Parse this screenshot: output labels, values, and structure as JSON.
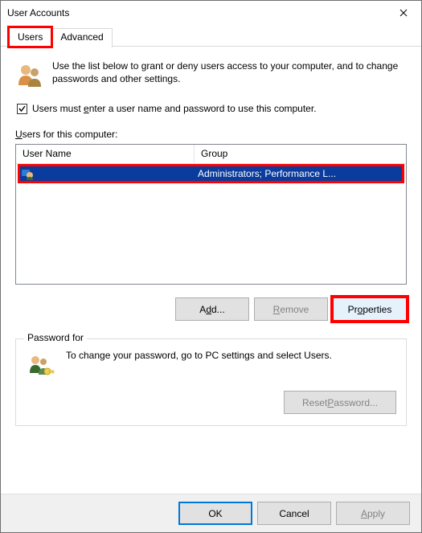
{
  "window": {
    "title": "User Accounts"
  },
  "tabs": [
    {
      "label": "Users",
      "active": true
    },
    {
      "label": "Advanced",
      "active": false
    }
  ],
  "intro": "Use the list below to grant or deny users access to your computer, and to change passwords and other settings.",
  "checkbox": {
    "checked": true,
    "label_pre": "Users must ",
    "label_hot": "e",
    "label_post": "nter a user name and password to use this computer."
  },
  "usersLabel": {
    "hot": "U",
    "rest": "sers for this computer:"
  },
  "columns": {
    "name": "User Name",
    "group": "Group"
  },
  "rows": [
    {
      "name": "",
      "group": "Administrators; Performance L..."
    }
  ],
  "buttons": {
    "add": {
      "pre": "A",
      "hot": "d",
      "post": "d..."
    },
    "remove": {
      "hot": "R",
      "rest": "emove"
    },
    "properties": {
      "pre": "Pr",
      "hot": "o",
      "post": "perties"
    }
  },
  "passwordBox": {
    "legend": "Password for ",
    "text": "To change your password, go to PC settings and select Users.",
    "reset": {
      "pre": "Reset ",
      "hot": "P",
      "post": "assword..."
    }
  },
  "bottom": {
    "ok": "OK",
    "cancel": "Cancel",
    "apply": {
      "hot": "A",
      "rest": "pply"
    }
  }
}
